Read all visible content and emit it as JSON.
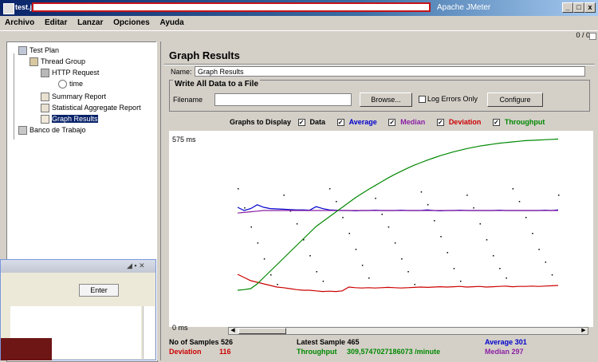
{
  "window": {
    "title_prefix": "test.jmx",
    "app_title": "Apache JMeter",
    "buttons": [
      "_",
      "□",
      "x"
    ]
  },
  "menu": [
    "Archivo",
    "Editar",
    "Lanzar",
    "Opciones",
    "Ayuda"
  ],
  "toolbar": {
    "counter": "0 / 0"
  },
  "tree": {
    "items": [
      {
        "label": "Test Plan",
        "icon": "testplan-icon"
      },
      {
        "label": "Thread Group",
        "icon": "thread-group-icon"
      },
      {
        "label": "HTTP Request",
        "icon": "http-request-icon"
      },
      {
        "label": "time",
        "icon": "timer-icon"
      },
      {
        "label": "Summary Report",
        "icon": "report-icon"
      },
      {
        "label": "Statistical Aggregate Report",
        "icon": "report-icon"
      },
      {
        "label": "Graph Results",
        "icon": "graph-icon"
      },
      {
        "label": "Banco de Trabajo",
        "icon": "workbench-icon"
      }
    ]
  },
  "panel": {
    "title": "Graph Results",
    "name_label": "Name:",
    "name_value": "Graph Results",
    "file_group_title": "Write All Data to a File",
    "filename_label": "Filename",
    "browse_button": "Browse...",
    "log_errors_label": "Log Errors Only",
    "configure_button": "Configure"
  },
  "graphs_to_display": {
    "label": "Graphs to Display",
    "options": [
      {
        "label": "Data",
        "checked": true,
        "color": "#000000"
      },
      {
        "label": "Average",
        "checked": true,
        "color": "#0000cc"
      },
      {
        "label": "Median",
        "checked": true,
        "color": "#8b1fa3"
      },
      {
        "label": "Deviation",
        "checked": true,
        "color": "#cc0000"
      },
      {
        "label": "Throughput",
        "checked": true,
        "color": "#008800"
      }
    ]
  },
  "graph": {
    "y_max_label": "575 ms",
    "y_min_label": "0 ms"
  },
  "chart_data": {
    "type": "line",
    "ylim": [
      0,
      575
    ],
    "series": [
      {
        "name": "Data",
        "color": "#000000",
        "values": [
          420,
          360,
          300,
          250,
          200,
          150,
          120,
          400,
          350,
          310,
          260,
          210,
          160,
          130,
          420,
          380,
          330,
          280,
          230,
          180,
          140,
          390,
          340,
          300,
          250,
          200,
          160,
          120,
          410,
          370,
          320,
          270,
          220,
          170,
          130,
          400,
          360,
          310,
          260,
          210,
          170,
          140,
          420,
          380,
          330,
          280,
          230,
          190,
          150,
          400
        ]
      },
      {
        "name": "Average",
        "color": "#0000cc",
        "values": [
          360,
          350,
          356,
          368,
          360,
          356,
          355,
          354,
          353,
          352,
          352,
          351,
          362,
          356,
          352,
          351,
          350,
          350,
          349,
          350,
          350,
          351,
          350,
          350,
          350,
          351,
          350,
          350,
          350,
          352,
          350,
          349,
          350,
          350,
          351,
          350,
          350,
          350,
          350,
          350,
          351,
          350,
          350,
          350,
          350,
          350,
          350,
          351,
          350,
          352
        ]
      },
      {
        "name": "Median",
        "color": "#8b1fa3",
        "values": [
          342,
          344,
          346,
          348,
          350,
          350,
          350,
          350,
          350,
          350,
          350,
          350,
          350,
          350,
          350,
          350,
          350,
          350,
          350,
          350,
          350,
          350,
          350,
          350,
          350,
          350,
          350,
          350,
          350,
          350,
          350,
          350,
          350,
          350,
          350,
          350,
          350,
          350,
          350,
          350,
          350,
          350,
          350,
          350,
          350,
          350,
          350,
          350,
          350,
          350
        ]
      },
      {
        "name": "Deviation",
        "color": "#cc0000",
        "values": [
          150,
          140,
          130,
          125,
          120,
          115,
          110,
          108,
          105,
          102,
          100,
          100,
          98,
          96,
          97,
          96,
          98,
          110,
          108,
          107,
          108,
          107,
          108,
          109,
          108,
          107,
          108,
          109,
          110,
          109,
          110,
          111,
          110,
          111,
          112,
          110,
          111,
          112,
          110,
          111,
          112,
          113,
          111,
          112,
          112,
          113,
          112,
          113,
          114,
          115
        ]
      },
      {
        "name": "Throughput",
        "color": "#008800",
        "values": [
          100,
          102,
          105,
          120,
          140,
          160,
          180,
          200,
          220,
          240,
          260,
          280,
          300,
          315,
          330,
          345,
          360,
          375,
          390,
          403,
          416,
          428,
          440,
          452,
          463,
          473,
          483,
          492,
          500,
          508,
          515,
          522,
          528,
          534,
          539,
          544,
          548,
          552,
          555,
          558,
          561,
          563,
          565,
          567,
          569,
          570,
          571,
          572,
          573,
          574
        ]
      }
    ]
  },
  "stats": {
    "samples_label": "No of Samples",
    "samples_value": "526",
    "latest_label": "Latest Sample",
    "latest_value": "465",
    "average_label": "Average",
    "average_value": "301",
    "deviation_label": "Deviation",
    "deviation_value": "116",
    "throughput_label": "Throughput",
    "throughput_value": "309,5747027186073 /minute",
    "median_label": "Median",
    "median_value": "297"
  },
  "overlay": {
    "button_label": "Enter"
  }
}
